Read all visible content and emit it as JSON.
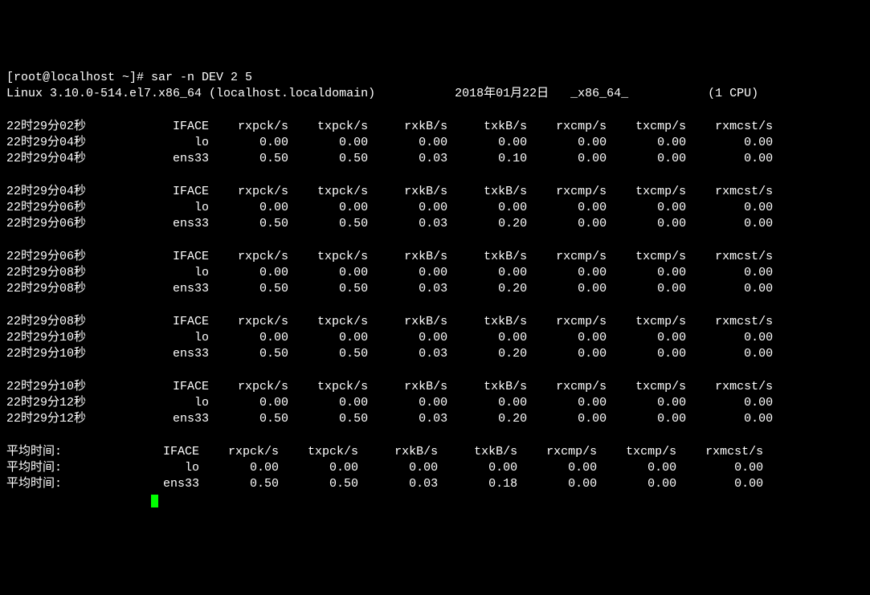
{
  "prompt": "[root@localhost ~]# ",
  "command": "sar -n DEV 2 5",
  "headerLine": {
    "kernel": "Linux 3.10.0-514.el7.x86_64 (localhost.localdomain)",
    "date": "2018年01月22日",
    "arch": "_x86_64_",
    "cpu": "(1 CPU)"
  },
  "columns": [
    "IFACE",
    "rxpck/s",
    "txpck/s",
    "rxkB/s",
    "txkB/s",
    "rxcmp/s",
    "txcmp/s",
    "rxmcst/s"
  ],
  "blocks": [
    {
      "headerTime": "22时29分02秒",
      "rows": [
        {
          "time": "22时29分04秒",
          "iface": "lo",
          "rxpck": "0.00",
          "txpck": "0.00",
          "rxkb": "0.00",
          "txkb": "0.00",
          "rxcmp": "0.00",
          "txcmp": "0.00",
          "rxmcst": "0.00"
        },
        {
          "time": "22时29分04秒",
          "iface": "ens33",
          "rxpck": "0.50",
          "txpck": "0.50",
          "rxkb": "0.03",
          "txkb": "0.10",
          "rxcmp": "0.00",
          "txcmp": "0.00",
          "rxmcst": "0.00"
        }
      ]
    },
    {
      "headerTime": "22时29分04秒",
      "rows": [
        {
          "time": "22时29分06秒",
          "iface": "lo",
          "rxpck": "0.00",
          "txpck": "0.00",
          "rxkb": "0.00",
          "txkb": "0.00",
          "rxcmp": "0.00",
          "txcmp": "0.00",
          "rxmcst": "0.00"
        },
        {
          "time": "22时29分06秒",
          "iface": "ens33",
          "rxpck": "0.50",
          "txpck": "0.50",
          "rxkb": "0.03",
          "txkb": "0.20",
          "rxcmp": "0.00",
          "txcmp": "0.00",
          "rxmcst": "0.00"
        }
      ]
    },
    {
      "headerTime": "22时29分06秒",
      "rows": [
        {
          "time": "22时29分08秒",
          "iface": "lo",
          "rxpck": "0.00",
          "txpck": "0.00",
          "rxkb": "0.00",
          "txkb": "0.00",
          "rxcmp": "0.00",
          "txcmp": "0.00",
          "rxmcst": "0.00"
        },
        {
          "time": "22时29分08秒",
          "iface": "ens33",
          "rxpck": "0.50",
          "txpck": "0.50",
          "rxkb": "0.03",
          "txkb": "0.20",
          "rxcmp": "0.00",
          "txcmp": "0.00",
          "rxmcst": "0.00"
        }
      ]
    },
    {
      "headerTime": "22时29分08秒",
      "rows": [
        {
          "time": "22时29分10秒",
          "iface": "lo",
          "rxpck": "0.00",
          "txpck": "0.00",
          "rxkb": "0.00",
          "txkb": "0.00",
          "rxcmp": "0.00",
          "txcmp": "0.00",
          "rxmcst": "0.00"
        },
        {
          "time": "22时29分10秒",
          "iface": "ens33",
          "rxpck": "0.50",
          "txpck": "0.50",
          "rxkb": "0.03",
          "txkb": "0.20",
          "rxcmp": "0.00",
          "txcmp": "0.00",
          "rxmcst": "0.00"
        }
      ]
    },
    {
      "headerTime": "22时29分10秒",
      "rows": [
        {
          "time": "22时29分12秒",
          "iface": "lo",
          "rxpck": "0.00",
          "txpck": "0.00",
          "rxkb": "0.00",
          "txkb": "0.00",
          "rxcmp": "0.00",
          "txcmp": "0.00",
          "rxmcst": "0.00"
        },
        {
          "time": "22时29分12秒",
          "iface": "ens33",
          "rxpck": "0.50",
          "txpck": "0.50",
          "rxkb": "0.03",
          "txkb": "0.20",
          "rxcmp": "0.00",
          "txcmp": "0.00",
          "rxmcst": "0.00"
        }
      ]
    }
  ],
  "averageLabel": "平均时间:",
  "averageRows": [
    {
      "iface": "lo",
      "rxpck": "0.00",
      "txpck": "0.00",
      "rxkb": "0.00",
      "txkb": "0.00",
      "rxcmp": "0.00",
      "txcmp": "0.00",
      "rxmcst": "0.00"
    },
    {
      "iface": "ens33",
      "rxpck": "0.50",
      "txpck": "0.50",
      "rxkb": "0.03",
      "txkb": "0.18",
      "rxcmp": "0.00",
      "txcmp": "0.00",
      "rxmcst": "0.00"
    }
  ]
}
